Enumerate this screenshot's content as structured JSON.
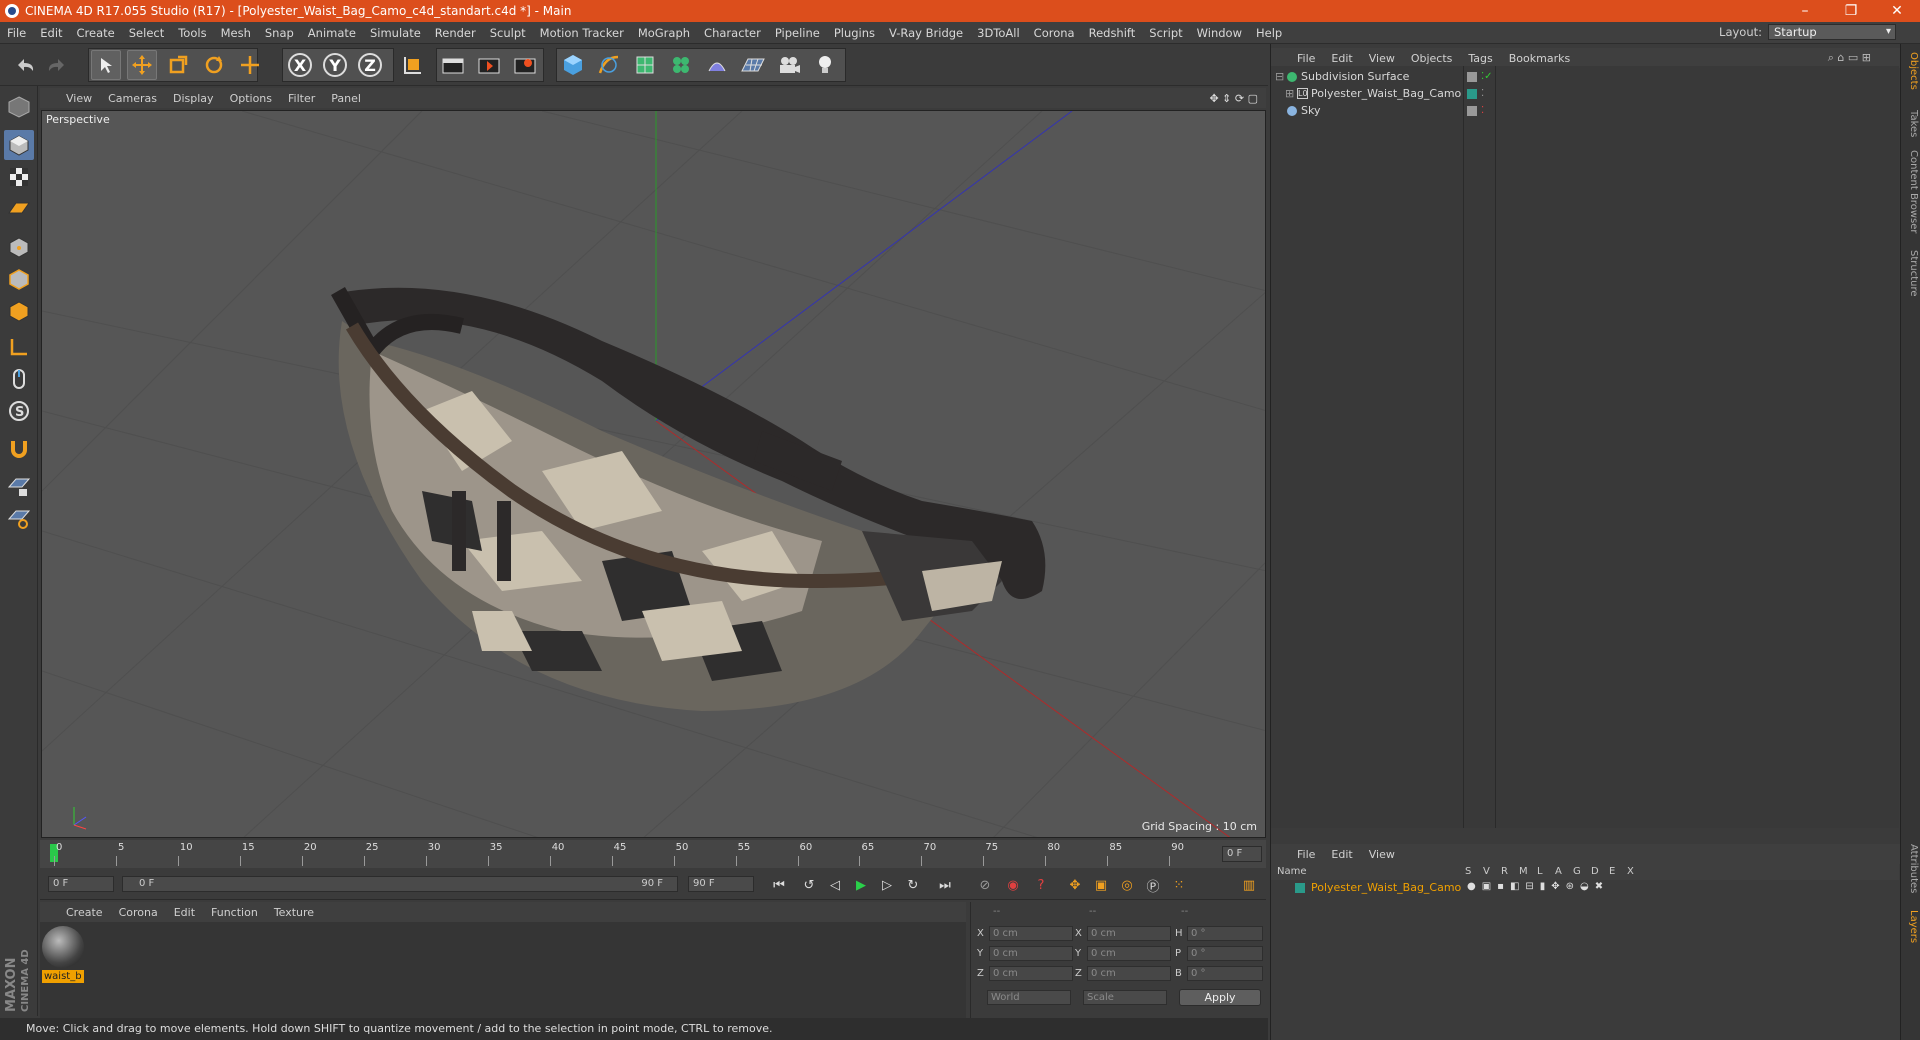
{
  "window": {
    "title": "CINEMA 4D R17.055 Studio (R17) - [Polyester_Waist_Bag_Camo_c4d_standart.c4d *] - Main",
    "minimize": "–",
    "maximize": "❐",
    "close": "✕"
  },
  "menu": [
    "File",
    "Edit",
    "Create",
    "Select",
    "Tools",
    "Mesh",
    "Snap",
    "Animate",
    "Simulate",
    "Render",
    "Sculpt",
    "Motion Tracker",
    "MoGraph",
    "Character",
    "Pipeline",
    "Plugins",
    "V-Ray Bridge",
    "3DToAll",
    "Corona",
    "Redshift",
    "Script",
    "Window",
    "Help"
  ],
  "layout": {
    "label": "Layout:",
    "value": "Startup"
  },
  "toolbar": {
    "x": "X",
    "y": "Y",
    "z": "Z"
  },
  "viewport": {
    "menu": [
      "View",
      "Cameras",
      "Display",
      "Options",
      "Filter",
      "Panel"
    ],
    "label": "Perspective",
    "grid_spacing": "Grid Spacing : 10 cm"
  },
  "timeline": {
    "ticks": [
      "0",
      "5",
      "10",
      "15",
      "20",
      "25",
      "30",
      "35",
      "40",
      "45",
      "50",
      "55",
      "60",
      "65",
      "70",
      "75",
      "80",
      "85",
      "90"
    ],
    "end_frame": "0 F"
  },
  "transport": {
    "start": "0 F",
    "range_start": "0 F",
    "range_end": "90 F",
    "end": "90 F"
  },
  "material": {
    "menu": [
      "Create",
      "Corona",
      "Edit",
      "Function",
      "Texture"
    ],
    "item": "waist_b"
  },
  "coords": {
    "head": [
      "--",
      "--",
      "--"
    ],
    "rows": [
      {
        "a": "X",
        "av": "0 cm",
        "b": "X",
        "bv": "0 cm",
        "c": "H",
        "cv": "0 °"
      },
      {
        "a": "Y",
        "av": "0 cm",
        "b": "Y",
        "bv": "0 cm",
        "c": "P",
        "cv": "0 °"
      },
      {
        "a": "Z",
        "av": "0 cm",
        "b": "Z",
        "bv": "0 cm",
        "c": "B",
        "cv": "0 °"
      }
    ],
    "world": "World",
    "scale": "Scale",
    "apply": "Apply"
  },
  "status": "Move: Click and drag to move elements. Hold down SHIFT to quantize movement / add to the selection in point mode, CTRL to remove.",
  "brand": {
    "maxon": "MAXON",
    "product": "CINEMA 4D"
  },
  "objects": {
    "menu": [
      "File",
      "Edit",
      "View",
      "Objects",
      "Tags",
      "Bookmarks"
    ],
    "items": [
      "Subdivision Surface",
      "Polyester_Waist_Bag_Camo",
      "Sky"
    ]
  },
  "layers": {
    "menu": [
      "File",
      "Edit",
      "View"
    ],
    "name_header": "Name",
    "cols": [
      "S",
      "V",
      "R",
      "M",
      "L",
      "A",
      "G",
      "D",
      "E",
      "X"
    ],
    "row": "Polyester_Waist_Bag_Camo"
  },
  "sidetabs": [
    "Objects",
    "Takes",
    "Content Browser",
    "Structure",
    "Attributes",
    "Layers"
  ],
  "colors": {
    "titlebar": "#dc4e1c",
    "layer_name": "#f0a000"
  }
}
